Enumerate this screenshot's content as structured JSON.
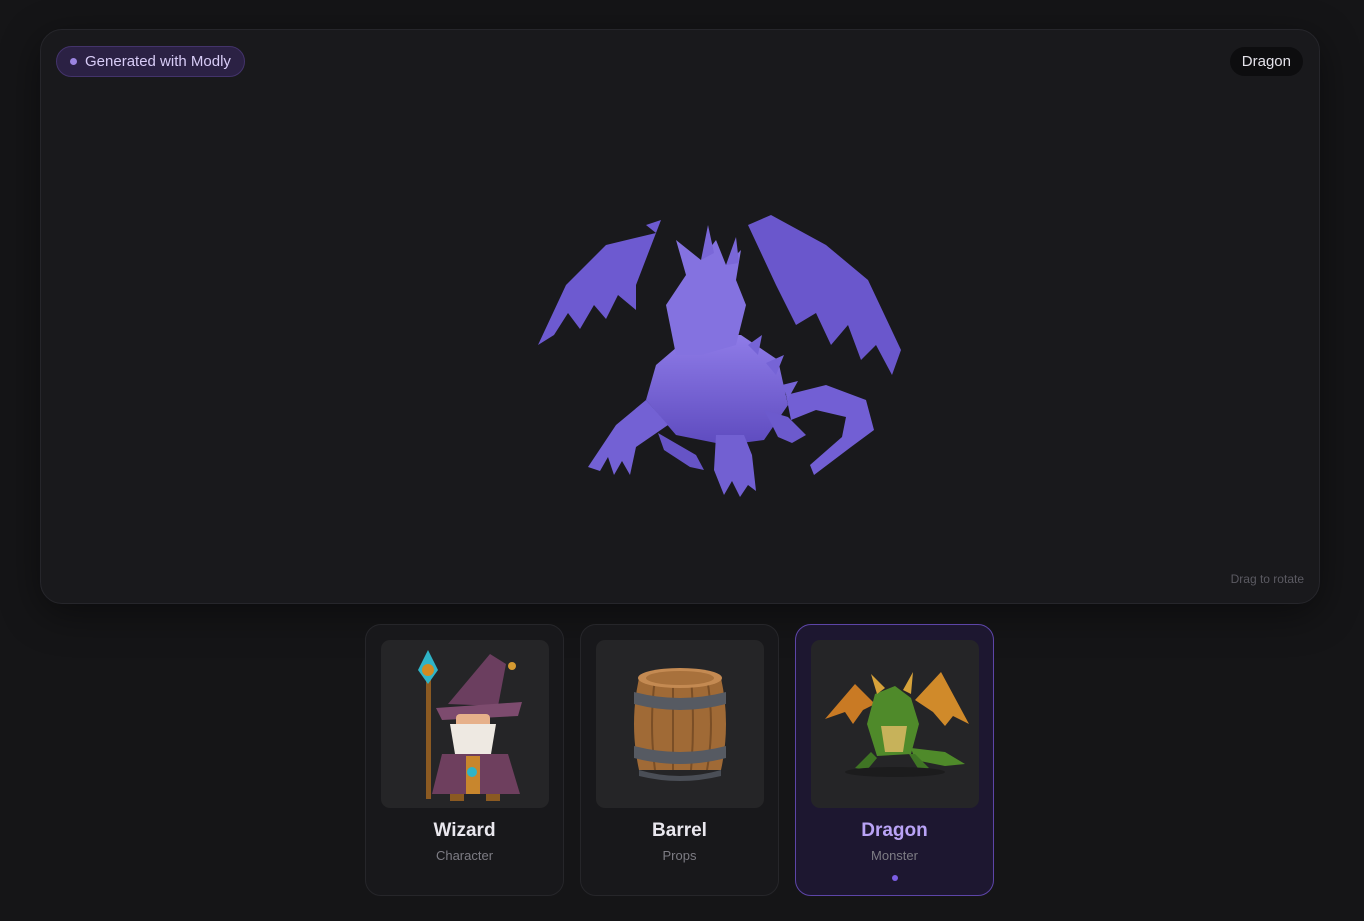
{
  "viewer": {
    "generated_label": "Generated with Modly",
    "model_name": "Dragon",
    "hint": "Drag to rotate"
  },
  "models": [
    {
      "title": "Wizard",
      "category": "Character",
      "icon": "wizard-thumbnail"
    },
    {
      "title": "Barrel",
      "category": "Props",
      "icon": "barrel-thumbnail"
    },
    {
      "title": "Dragon",
      "category": "Monster",
      "icon": "dragon-thumbnail",
      "selected": true
    }
  ],
  "colors": {
    "accent": "#7c5ee4",
    "model": "#7a66d6",
    "background": "#151517"
  }
}
